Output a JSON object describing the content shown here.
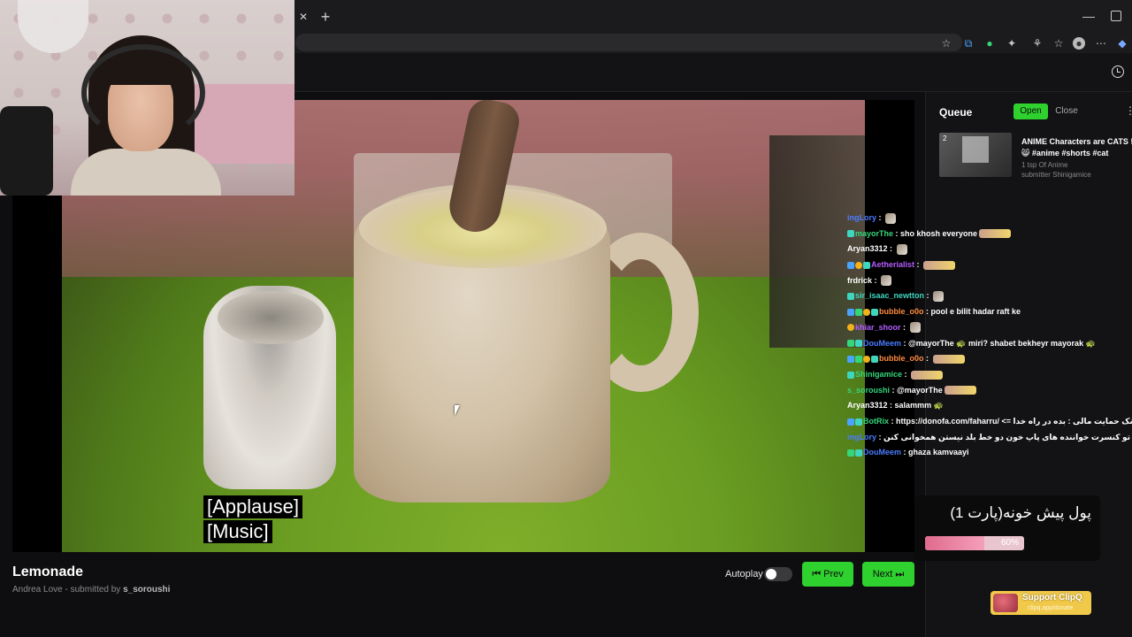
{
  "browser": {
    "tab_close": "✕",
    "new_tab": "+",
    "window_minimize": "—"
  },
  "toolbar_icons": [
    "star-icon",
    "translate-icon",
    "extension-icon",
    "extensions-puzzle-icon",
    "accounts-icon",
    "bookmark-icon",
    "profile-icon",
    "menu-icon",
    "copilot-icon"
  ],
  "player": {
    "captions": [
      "[Applause]",
      "[Music]"
    ],
    "title": "Lemonade",
    "author": "Andrea Love",
    "submitted_by_label": "submitted by",
    "submitter": "s_soroushi",
    "autoplay_label": "Autoplay",
    "autoplay_on": false,
    "prev_label": "Prev",
    "next_label": "Next"
  },
  "queue": {
    "title": "Queue",
    "open_label": "Open",
    "close_label": "Close",
    "items": [
      {
        "number": "2",
        "title_line1": "ANIME Characters are CATS !",
        "title_line2": "😸 #anime #shorts #cat",
        "channel": "1 tsp Of Anime",
        "submitter": "submitter Shinigamice"
      }
    ]
  },
  "chat": [
    {
      "badges": [],
      "user": "ingLory",
      "user_color": "#4a7bff",
      "text": "",
      "emote": "small"
    },
    {
      "badges": [
        "teal"
      ],
      "user": "mayorThe",
      "user_color": "#35d67a",
      "text": "sho khosh everyone",
      "emote": "wide"
    },
    {
      "badges": [],
      "user": "Aryan3312",
      "user_color": "#ffffff",
      "text": "",
      "emote": "small"
    },
    {
      "badges": [
        "blue",
        "gold",
        "teal"
      ],
      "user": "Aetherialist",
      "user_color": "#b35cff",
      "text": "",
      "emote": "wide"
    },
    {
      "badges": [],
      "user": "frdrick",
      "user_color": "#ffffff",
      "text": "",
      "emote": "small"
    },
    {
      "badges": [
        "teal"
      ],
      "user": "sir_isaac_newtton",
      "user_color": "#3fd6c0",
      "text": "",
      "emote": "small"
    },
    {
      "badges": [
        "blue",
        "green",
        "gold",
        "teal"
      ],
      "user": "bubble_o0o",
      "user_color": "#ff8a3d",
      "text": "pool e bilit hadar raft ke",
      "emote": ""
    },
    {
      "badges": [
        "gold"
      ],
      "user": "khiar_shoor",
      "user_color": "#b35cff",
      "text": "",
      "emote": "small"
    },
    {
      "badges": [
        "green",
        "teal"
      ],
      "user": "DouMeem",
      "user_color": "#4a7bff",
      "text": "@mayorThe 🐢 miri? shabet bekheyr mayorak 🐢",
      "emote": ""
    },
    {
      "badges": [
        "blue",
        "green",
        "gold",
        "teal"
      ],
      "user": "bubble_o0o",
      "user_color": "#ff8a3d",
      "text": "",
      "emote": "wide"
    },
    {
      "badges": [
        "teal"
      ],
      "user": "Shinigamice",
      "user_color": "#35d67a",
      "text": "",
      "emote": "wide"
    },
    {
      "badges": [],
      "user": "s_soroushi",
      "user_color": "#35d67a",
      "text": "@mayorThe",
      "emote": "wide"
    },
    {
      "badges": [],
      "user": "Aryan3312",
      "user_color": "#ffffff",
      "text": "salammm 🐢",
      "emote": ""
    },
    {
      "badges": [
        "blue",
        "teal"
      ],
      "user": "BotRix",
      "user_color": "#35d67a",
      "text": "https://donofa.com/faharru/ <= لینک حمایت مالی : بده در راه خدا",
      "emote": "small"
    },
    {
      "badges": [],
      "user": "ingLory",
      "user_color": "#4a7bff",
      "text": "اینجا هم تو کنسرت خواننده های پاپ خون دو خط بلد نیستن همخوانی کنن",
      "emote": ""
    },
    {
      "badges": [
        "green",
        "teal"
      ],
      "user": "DouMeem",
      "user_color": "#4a7bff",
      "text": "ghaza kamvaayi",
      "emote": ""
    }
  ],
  "promo": {
    "text": "پول پیش خونه(پارت 1)",
    "progress_label": "60%",
    "progress_fraction": 0.6,
    "color": "#e06a8d"
  },
  "support": {
    "label": "Support ClipQ",
    "url_text": "clipq.app/donate"
  },
  "colors": {
    "accent_green": "#2fd12f",
    "background": "#0e0e10",
    "support_yellow": "#f1c94a"
  }
}
